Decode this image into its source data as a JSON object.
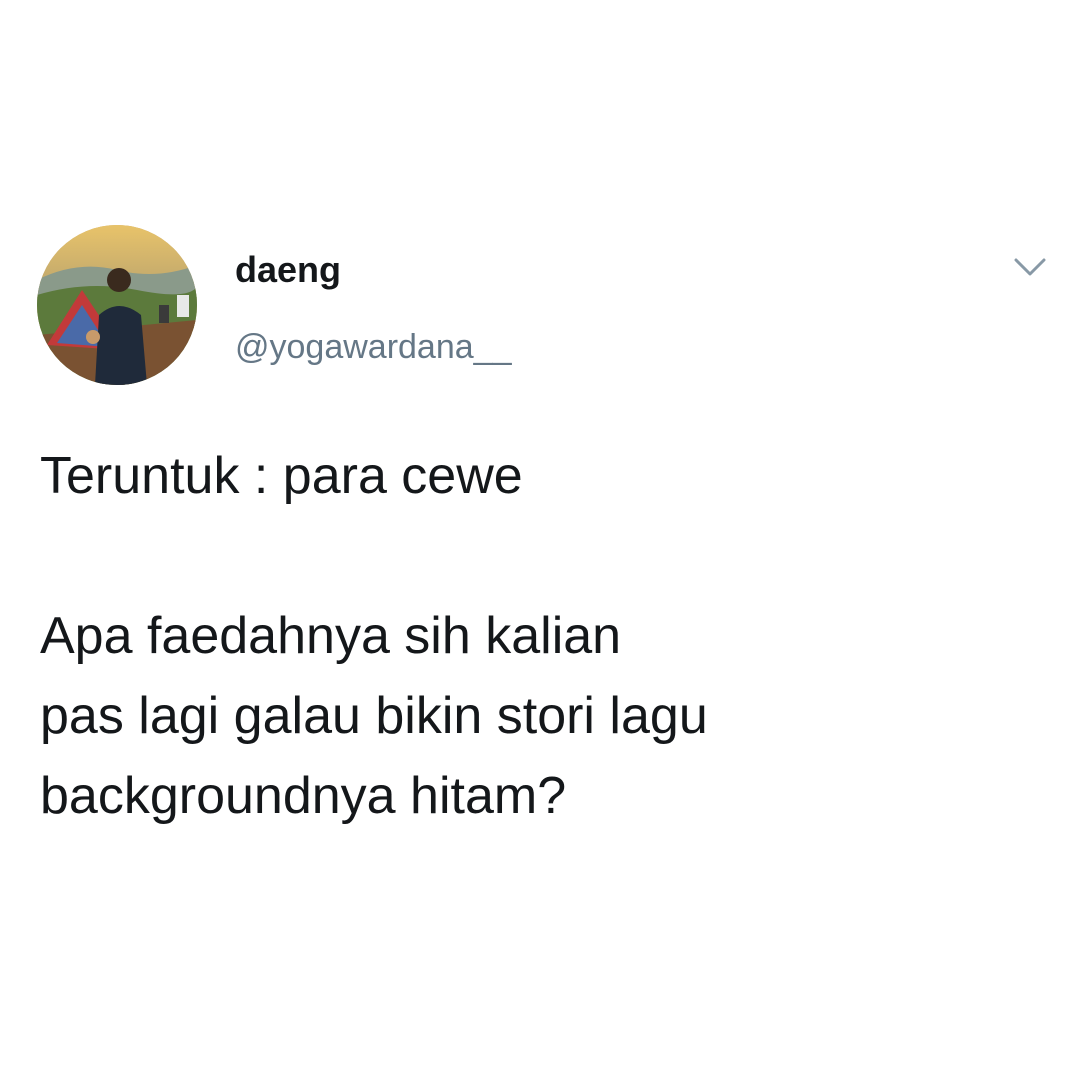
{
  "author": {
    "display_name": "daeng",
    "handle": "@yogawardana__",
    "avatar_icon": "profile-photo"
  },
  "menu": {
    "icon": "chevron-down-icon"
  },
  "tweet": {
    "lines": [
      "Teruntuk : para cewe",
      "",
      "Apa faedahnya sih kalian",
      "pas lagi galau bikin stori lagu",
      "backgroundnya hitam?"
    ]
  },
  "colors": {
    "name": "#14171a",
    "handle": "#657786",
    "caret": "#8899a6",
    "background": "#ffffff"
  }
}
